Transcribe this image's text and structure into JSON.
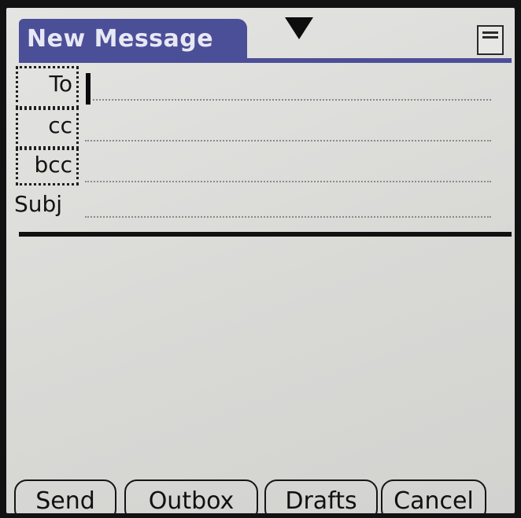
{
  "header": {
    "title": "New Message",
    "menu_icon": "triangle-down-icon",
    "note_icon": "note-icon"
  },
  "fields": {
    "to": {
      "label": "To",
      "value": ""
    },
    "cc": {
      "label": "cc",
      "value": ""
    },
    "bcc": {
      "label": "bcc",
      "value": ""
    },
    "subject": {
      "label": "Subj",
      "value": ""
    }
  },
  "body": {
    "value": ""
  },
  "buttons": {
    "send": "Send",
    "outbox": "Outbox",
    "drafts": "Drafts",
    "cancel": "Cancel"
  },
  "colors": {
    "title_bar": "#4b4f97",
    "screen_background": "#dcdcd9"
  }
}
